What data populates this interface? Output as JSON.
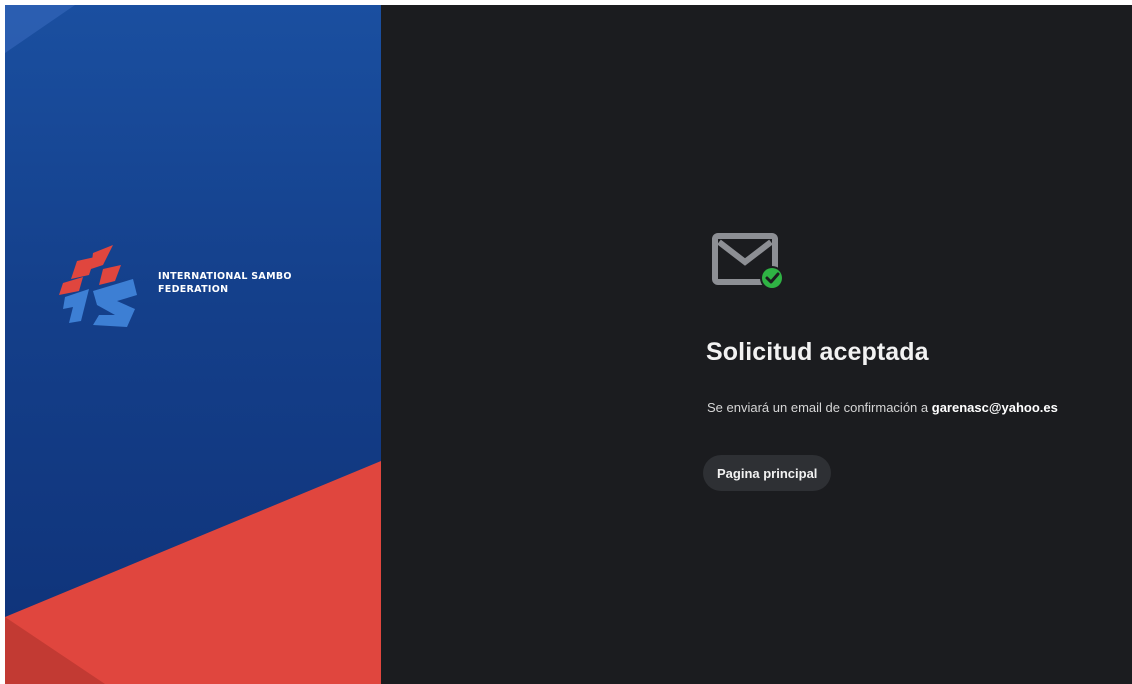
{
  "brand": {
    "name_line1": "INTERNATIONAL SAMBO",
    "name_line2": "FEDERATION",
    "logo_icon": "fias-logo-icon",
    "colors": {
      "blue": "#1a4fa0",
      "red": "#e0463e"
    }
  },
  "confirmation": {
    "icon": "mail-check-icon",
    "title": "Solicitud aceptada",
    "message_prefix": "Se enviará un email de confirmación a",
    "email": "garenasc@yahoo.es",
    "home_button_label": "Pagina principal"
  },
  "colors": {
    "right_background": "#1b1c1f",
    "button_background": "#2e3034",
    "success_green": "#2fb344"
  }
}
